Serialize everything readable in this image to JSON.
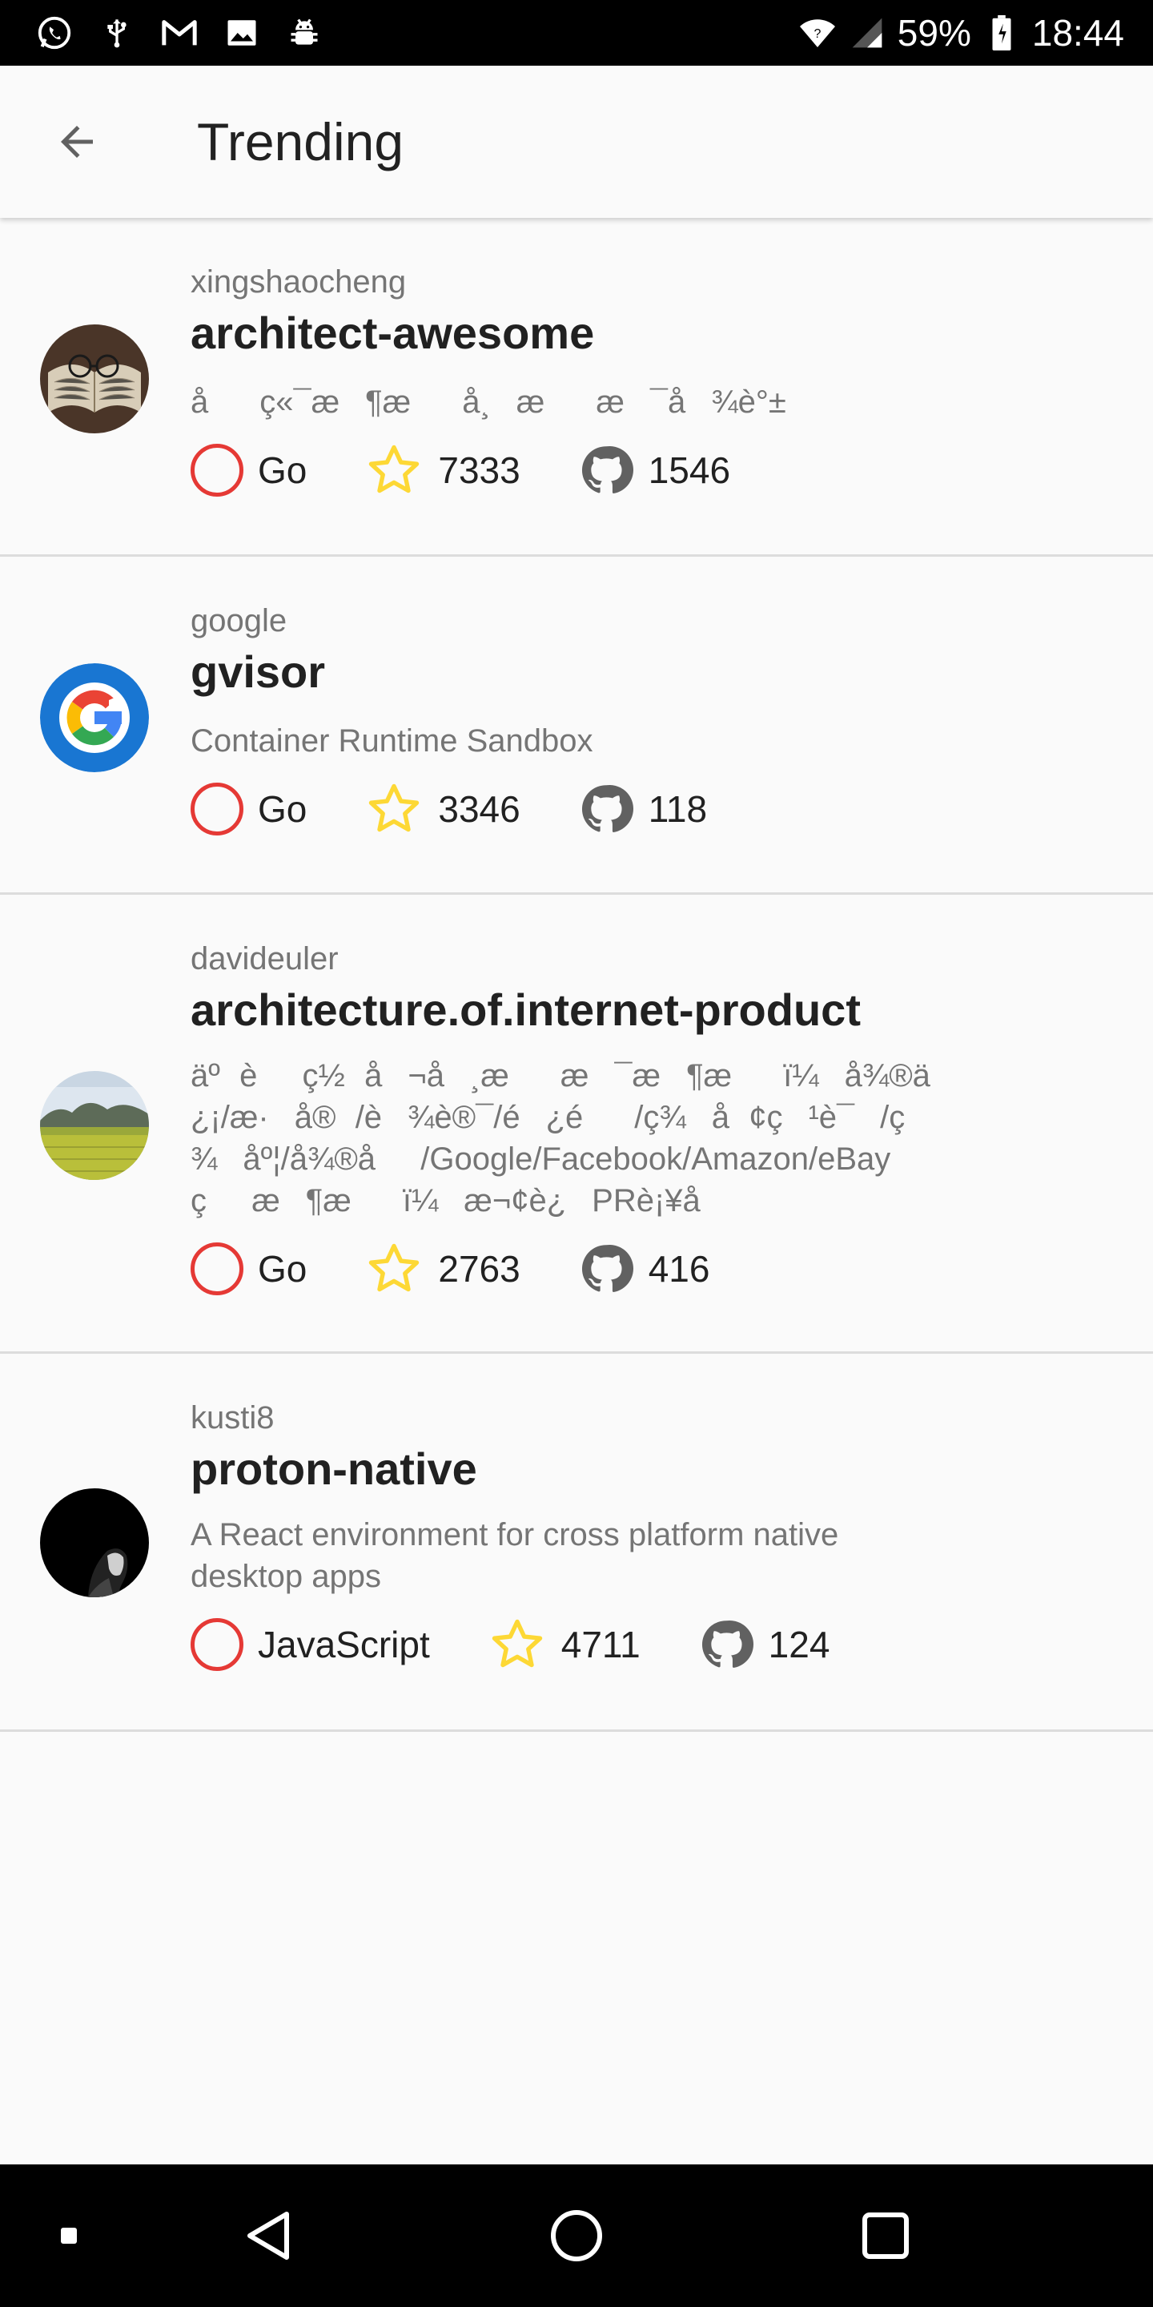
{
  "status_bar": {
    "battery": "59%",
    "time": "18:44",
    "left_icons": [
      "whatsapp-icon",
      "usb-icon",
      "gmail-icon",
      "image-icon",
      "android-debug-icon"
    ],
    "right_icons": [
      "wifi-icon",
      "signal-icon",
      "battery-icon"
    ]
  },
  "app_bar": {
    "title": "Trending",
    "back_icon": "arrow-back-icon"
  },
  "colors": {
    "language_ring": "#e53935",
    "star": "#fdd835",
    "github_icon": "#616161",
    "divider": "#dcdcdc"
  },
  "repos": [
    {
      "owner": "xingshaocheng",
      "name": "architect-awesome",
      "description": "åç«¯æ¶æå¸ææ¯å¾è°±",
      "language": "Go",
      "stars": "7333",
      "forks": "1546",
      "avatar": "book-glasses-photo"
    },
    {
      "owner": "google",
      "name": "gvisor",
      "description": "Container Runtime Sandbox",
      "language": "Go",
      "stars": "3346",
      "forks": "118",
      "avatar": "google-logo"
    },
    {
      "owner": "davideuler",
      "name": "architecture.of.internet-product",
      "description": "äºèç½å¬å¸ææ¯æ¶æï¼å¾®ä¿¡/æ·å®/è¾è®¯/é¿é/ç¾å¢ç¹è¯/ç¾åº¦/å¾®å/Google/Facebook/Amazon/eBayçæ¶æï¼æ¬¢è¿PRè¡¥å",
      "language": "Go",
      "stars": "2763",
      "forks": "416",
      "avatar": "landscape-photo"
    },
    {
      "owner": "kusti8",
      "name": "proton-native",
      "description": "A React environment for cross platform native desktop apps",
      "language": "JavaScript",
      "stars": "4711",
      "forks": "124",
      "avatar": "dark-portrait-photo"
    }
  ],
  "nav_bar": {
    "icons": [
      "dot-icon",
      "back-triangle-icon",
      "home-circle-icon",
      "recents-square-icon"
    ]
  }
}
